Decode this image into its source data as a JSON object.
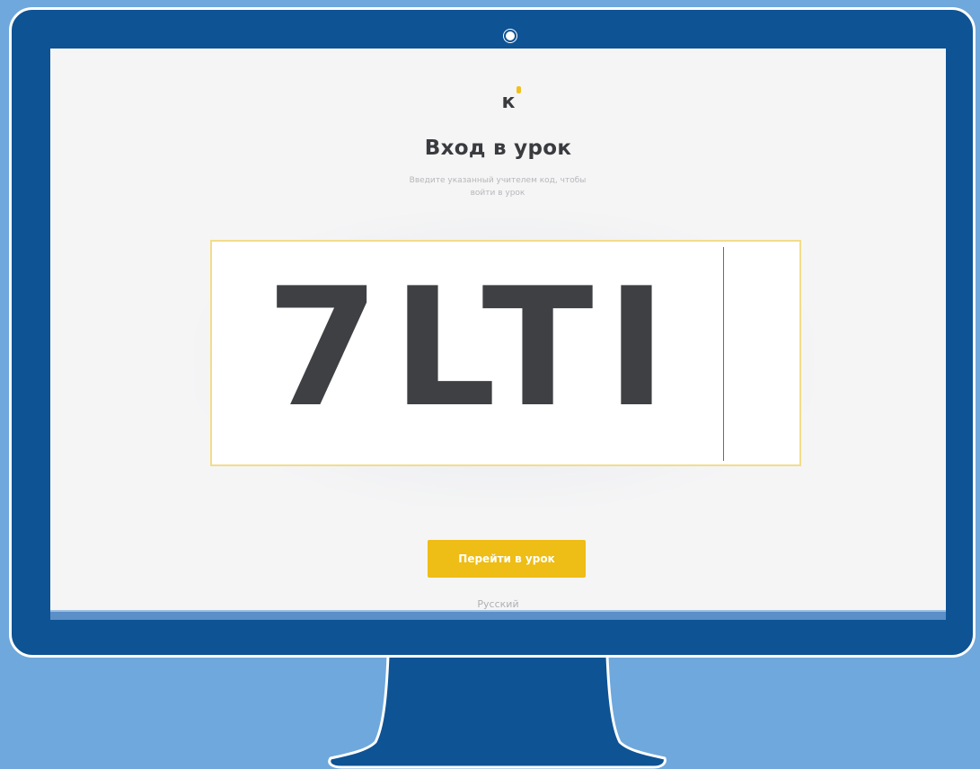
{
  "page": {
    "title": "Вход в урок",
    "subtitle": "Введите указанный учителем код, чтобы войти в урок",
    "logo_letter": "к"
  },
  "code_input": {
    "value": "7LTI"
  },
  "submit_button": {
    "label": "Перейти в урок"
  },
  "language": {
    "selected": "Русский"
  },
  "colors": {
    "background": "#6fa8dc",
    "monitor_body": "#0e5394",
    "screen": "#f5f5f6",
    "accent": "#eebd16",
    "text_dark": "#3a3b3f"
  },
  "icons": {
    "logo": "logo-k-icon",
    "camera": "camera-dot-icon"
  }
}
